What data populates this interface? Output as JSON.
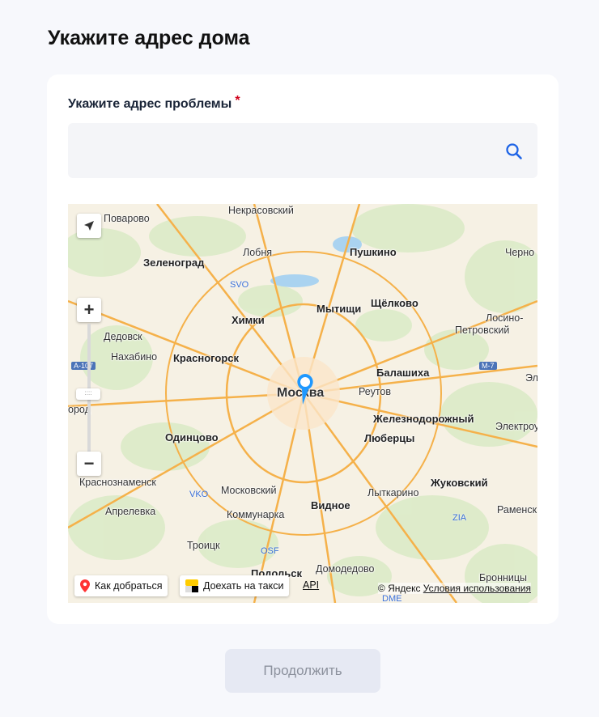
{
  "page_title": "Укажите адрес дома",
  "form": {
    "address_label": "Укажите адрес проблемы",
    "required_mark": "*",
    "address_value": "",
    "search_icon": "search-icon"
  },
  "map": {
    "cities": {
      "povarovo": "Поварово",
      "nekrasovsky": "Некрасовский",
      "zelenograd": "Зеленоград",
      "lobnya": "Лобня",
      "pushkino": "Пушкино",
      "cherno": "Черно",
      "mytishchi": "Мытищи",
      "shchyolkovo": "Щёлково",
      "khimki": "Химки",
      "losino_1": "Лосино-",
      "losino_2": "Петровский",
      "dedovsk": "Дедовск",
      "nakhabino": "Нахабино",
      "krasnogorsk": "Красногорск",
      "balashikha": "Балашиха",
      "reutov": "Реутов",
      "moskva": "Москва",
      "zheleznodorozhny": "Железнодорожный",
      "elektrou": "Электроу",
      "el": "Эл",
      "odintsovo": "Одинцово",
      "lyubertsy": "Люберцы",
      "krasnoznamensk": "Краснознаменск",
      "moskovsky": "Московский",
      "zhukovsky": "Жуковский",
      "lytkarino": "Лыткарино",
      "aprelevka": "Апрелевка",
      "kommunarka": "Коммунарка",
      "vidnoye": "Видное",
      "ramensk": "Раменск",
      "troitsk": "Троицк",
      "podolsk": "Подольск",
      "domodedovo": "Домодедово",
      "bronnitsy": "Бронницы",
      "gorod": "ород"
    },
    "airports": {
      "svo": "SVO",
      "vko": "VKO",
      "osf": "OSF",
      "zia": "ZIA",
      "dme": "DME"
    },
    "roads": {
      "a107": "A-107",
      "m7": "M-7"
    },
    "zoom_in": "+",
    "zoom_out": "−",
    "slider_grip": "::::",
    "route_button": "Как добраться",
    "taxi_button": "Доехать на такси",
    "api_link": "API",
    "copyright": "© Яндекс",
    "terms_link": "Условия использования"
  },
  "continue_button": "Продолжить",
  "colors": {
    "accent": "#1e64e6",
    "required": "#d0021b",
    "marker": "#1e98ff"
  }
}
